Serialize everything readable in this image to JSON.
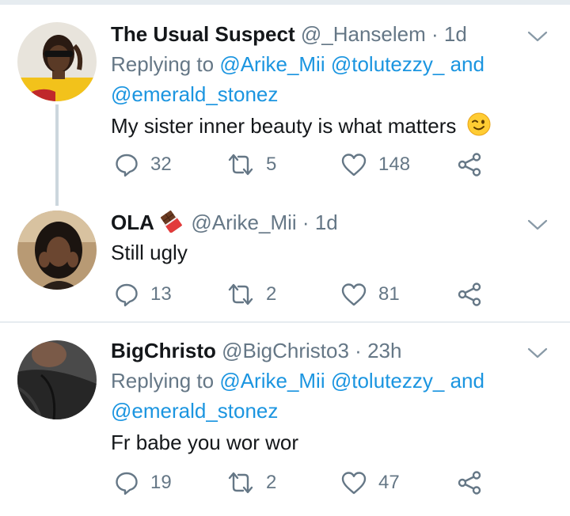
{
  "tweets": [
    {
      "name": "The Usual Suspect",
      "handle": "@_Hanselem",
      "separator": "·",
      "time": "1d",
      "replying_prefix": "Replying to",
      "replying_to": [
        "@Arike_Mii",
        "@tolutezzy_",
        "@emerald_stonez"
      ],
      "replying_and": "and",
      "text": "My sister inner beauty is what matters",
      "emoji": "winking-face",
      "replies": "32",
      "retweets": "5",
      "likes": "148"
    },
    {
      "name": "OLA",
      "name_emoji": "chocolate-bar",
      "handle": "@Arike_Mii",
      "separator": "·",
      "time": "1d",
      "text": "Still ugly",
      "replies": "13",
      "retweets": "2",
      "likes": "81"
    },
    {
      "name": "BigChristo",
      "handle": "@BigChristo3",
      "separator": "·",
      "time": "23h",
      "replying_prefix": "Replying to",
      "replying_to": [
        "@Arike_Mii",
        "@tolutezzy_",
        "@emerald_stonez"
      ],
      "replying_and": "and",
      "text": "Fr babe you wor wor",
      "replies": "19",
      "retweets": "2",
      "likes": "47"
    }
  ],
  "colors": {
    "text": "#14171a",
    "secondary": "#657786",
    "link": "#1b95e0",
    "divider": "#e6ecf0",
    "thread_line": "#ccd6dd"
  }
}
